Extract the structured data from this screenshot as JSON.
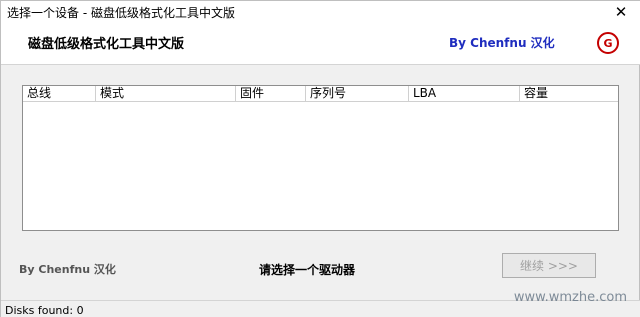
{
  "window": {
    "title": "选择一个设备 - 磁盘低级格式化工具中文版",
    "close_glyph": "✕"
  },
  "header": {
    "title": "磁盘低级格式化工具中文版",
    "credit": "By Chenfnu 汉化",
    "logo_icon": "g-logo-icon",
    "logo_glyph": "G"
  },
  "table": {
    "columns": [
      {
        "label": "总线"
      },
      {
        "label": "模式"
      },
      {
        "label": "固件"
      },
      {
        "label": "序列号"
      },
      {
        "label": "LBA"
      },
      {
        "label": "容量"
      }
    ],
    "rows": []
  },
  "footer": {
    "credit": "By Chenfnu 汉化",
    "prompt": "请选择一个驱动器",
    "continue_label": "继续 >>>"
  },
  "statusbar": {
    "text": "Disks found: 0"
  },
  "watermark": "www.wmzhe.com",
  "colors": {
    "accent": "#1f2dbf",
    "logo": "#c40000"
  }
}
